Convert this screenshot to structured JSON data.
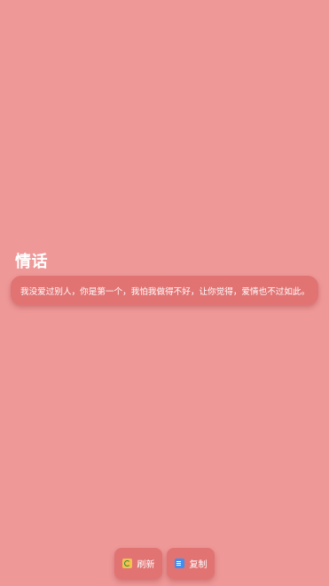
{
  "section": {
    "title": "情话"
  },
  "quote": {
    "text": "我没爱过别人，你是第一个，我怕我做得不好，让你觉得，爱情也不过如此。"
  },
  "actions": {
    "refresh_label": "刷新",
    "copy_label": "复制"
  },
  "icons": {
    "refresh": "refresh-icon",
    "copy": "copy-icon"
  },
  "colors": {
    "background": "#ef9898",
    "card": "#e27373",
    "text": "#ffffff"
  }
}
